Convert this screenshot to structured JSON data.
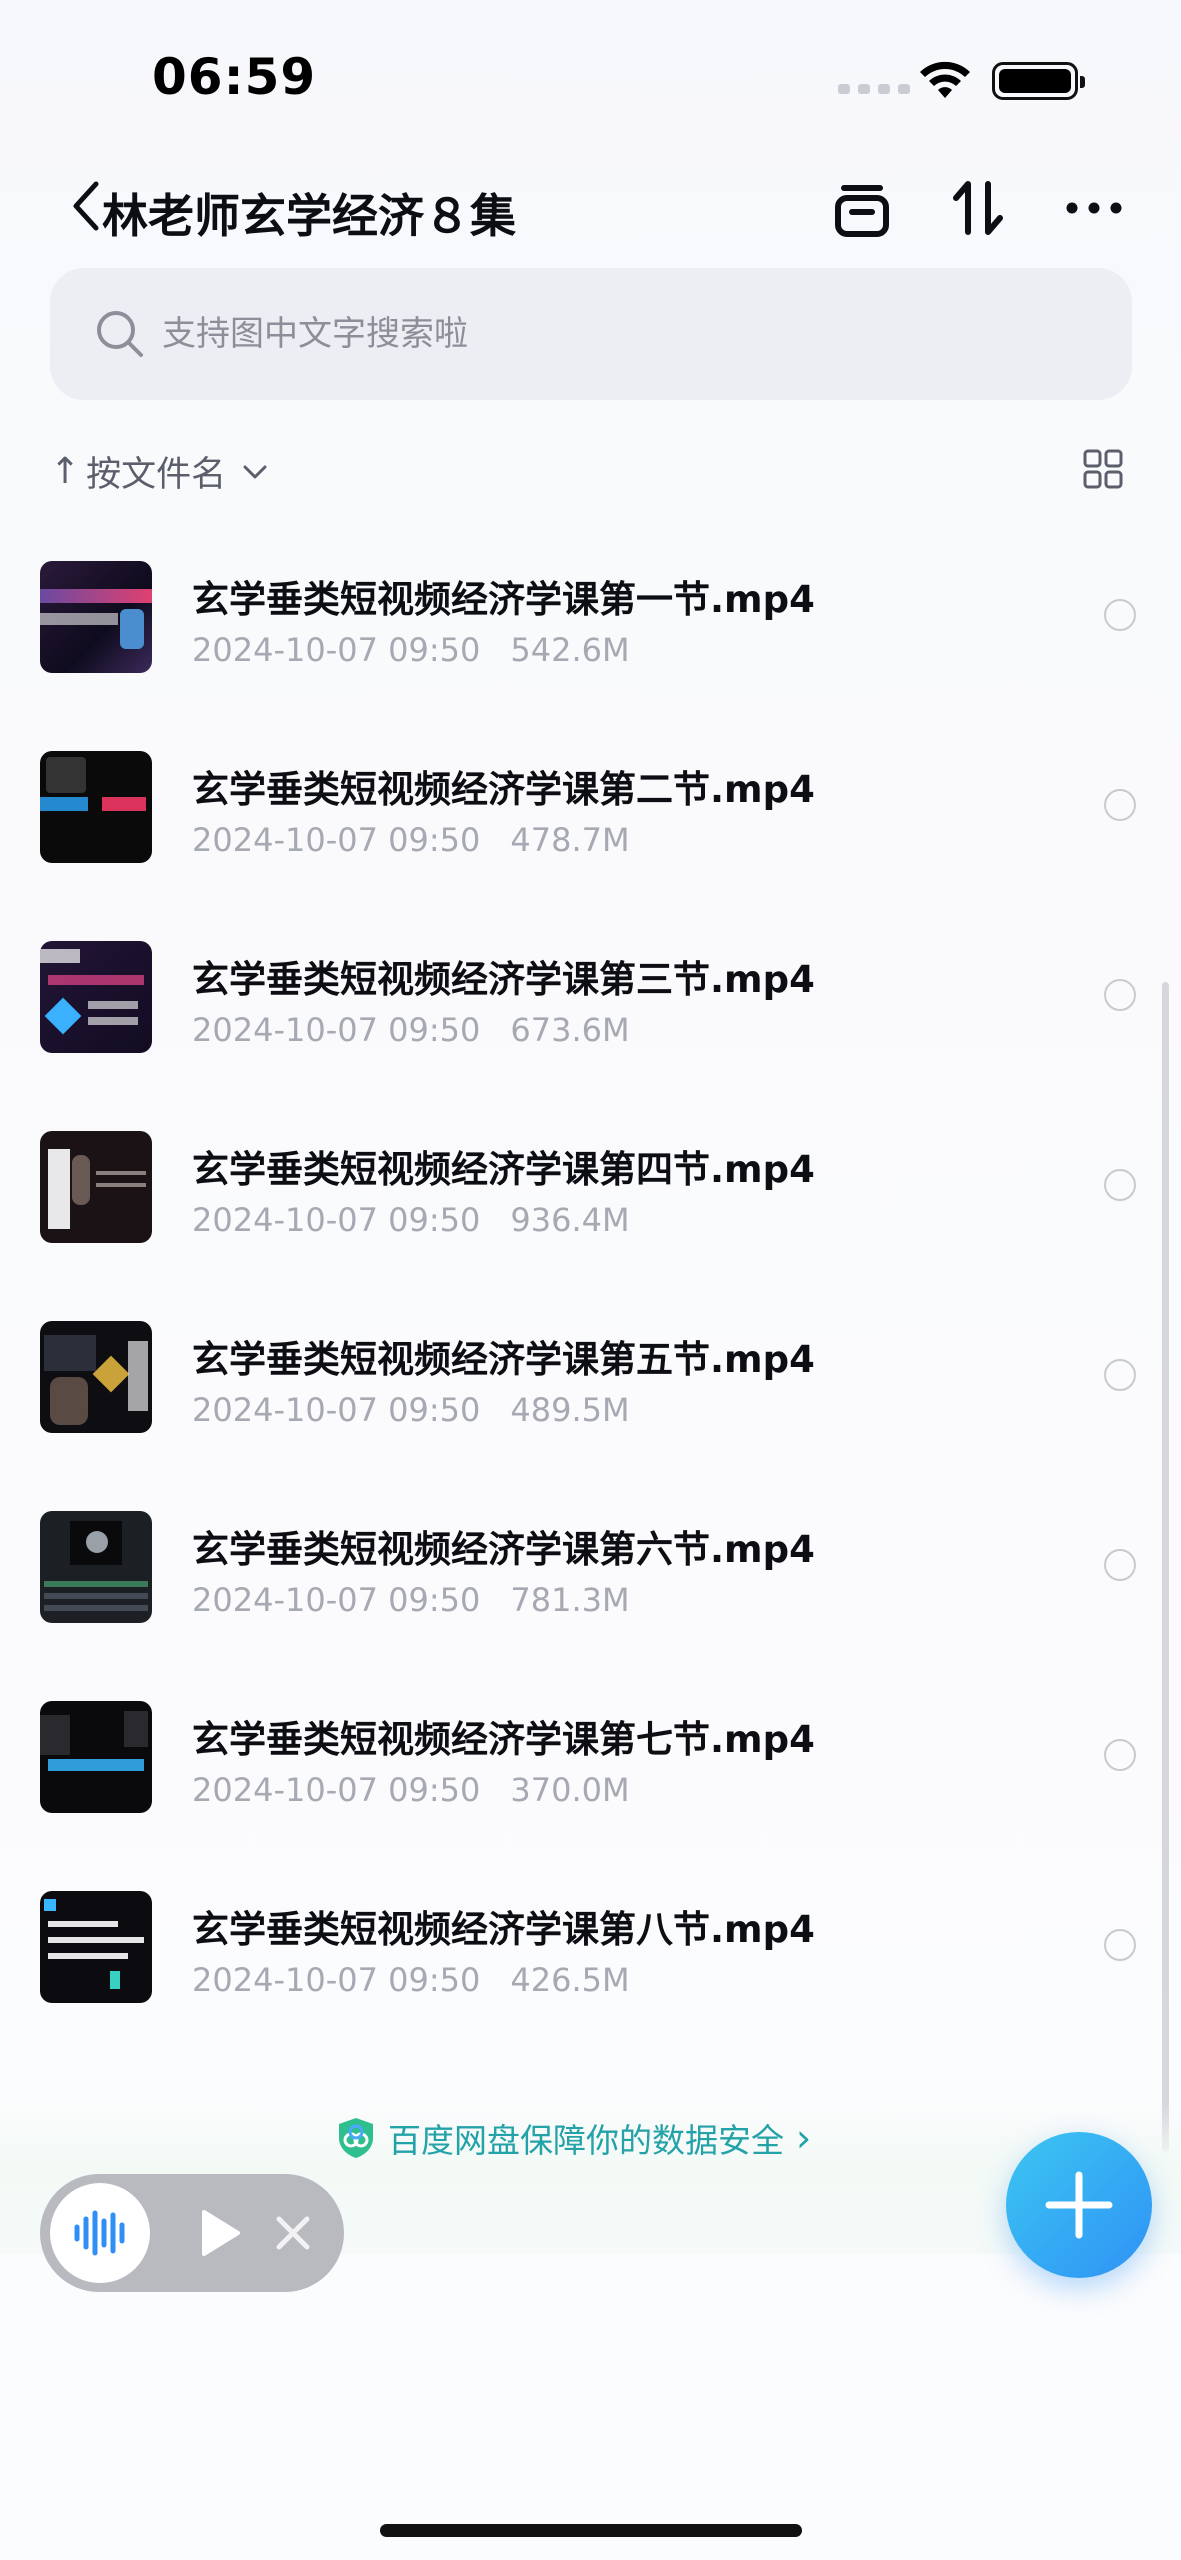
{
  "status_bar": {
    "time": "06:59"
  },
  "header": {
    "title": "林老师玄学经济８集"
  },
  "search": {
    "placeholder": "支持图中文字搜索啦"
  },
  "sort": {
    "arrow": "↑",
    "label": "按文件名"
  },
  "files": [
    {
      "name": "玄学垂类短视频经济学课第一节.mp4",
      "date": "2024-10-07 09:50",
      "size": "542.6M"
    },
    {
      "name": "玄学垂类短视频经济学课第二节.mp4",
      "date": "2024-10-07 09:50",
      "size": "478.7M"
    },
    {
      "name": "玄学垂类短视频经济学课第三节.mp4",
      "date": "2024-10-07 09:50",
      "size": "673.6M"
    },
    {
      "name": "玄学垂类短视频经济学课第四节.mp4",
      "date": "2024-10-07 09:50",
      "size": "936.4M"
    },
    {
      "name": "玄学垂类短视频经济学课第五节.mp4",
      "date": "2024-10-07 09:50",
      "size": "489.5M"
    },
    {
      "name": "玄学垂类短视频经济学课第六节.mp4",
      "date": "2024-10-07 09:50",
      "size": "781.3M"
    },
    {
      "name": "玄学垂类短视频经济学课第七节.mp4",
      "date": "2024-10-07 09:50",
      "size": "370.0M"
    },
    {
      "name": "玄学垂类短视频经济学课第八节.mp4",
      "date": "2024-10-07 09:50",
      "size": "426.5M"
    }
  ],
  "notice": {
    "text": "百度网盘保障你的数据安全",
    "arrow": "›"
  },
  "colors": {
    "accent": "#2f92f5",
    "notice": "#23a2a8",
    "meta": "#a6a9b2"
  },
  "icons": {
    "header": [
      "back-chevron-icon",
      "collapse-icon",
      "sort-swap-icon",
      "more-icon"
    ],
    "player": [
      "waveform-icon",
      "play-icon",
      "close-icon"
    ],
    "fab": "plus-icon"
  }
}
